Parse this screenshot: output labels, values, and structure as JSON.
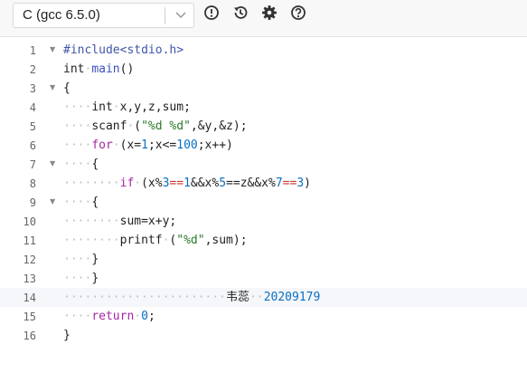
{
  "toolbar": {
    "language": "C (gcc 6.5.0)",
    "icons": [
      "chevron-down-icon",
      "alert-circle-icon",
      "history-icon",
      "gear-icon",
      "help-icon"
    ]
  },
  "editor": {
    "lines": [
      {
        "n": "1",
        "fold": true
      },
      {
        "n": "2"
      },
      {
        "n": "3",
        "fold": true
      },
      {
        "n": "4"
      },
      {
        "n": "5"
      },
      {
        "n": "6"
      },
      {
        "n": "7",
        "fold": true
      },
      {
        "n": "8"
      },
      {
        "n": "9",
        "fold": true
      },
      {
        "n": "10"
      },
      {
        "n": "11"
      },
      {
        "n": "12"
      },
      {
        "n": "13"
      },
      {
        "n": "14",
        "active": true
      },
      {
        "n": "15"
      },
      {
        "n": "16"
      }
    ],
    "tokens": {
      "l1": "#include<stdio.h>",
      "l2_kw": "int",
      "l2_fn": "main",
      "l2_rest": "()",
      "l3": "{",
      "l4_kw": "int",
      "l4_rest": "x,y,z,sum;",
      "l5_fn": "scanf",
      "l5_p1": "(",
      "l5_str": "\"%d %d\"",
      "l5_p2": ",&y,&z);",
      "l6_kw": "for",
      "l6_p1": "(x=",
      "l6_n1": "1",
      "l6_p2": ";x<=",
      "l6_n2": "100",
      "l6_p3": ";x++)",
      "l7": "{",
      "l8_kw": "if",
      "l8_p1": "(x%",
      "l8_n1": "3",
      "l8_p2": "==",
      "l8_n2": "1",
      "l8_p3": "&&x%",
      "l8_n3": "5",
      "l8_p4": "==z&&x%",
      "l8_n4": "7",
      "l8_p5": "==",
      "l8_n5": "3",
      "l8_p6": ")",
      "l9": "{",
      "l10": "sum=x+y;",
      "l11_fn": "printf",
      "l11_p1": "(",
      "l11_str": "\"%d\"",
      "l11_p2": ",sum);",
      "l12": "}",
      "l13": "}",
      "l14_name": "韦蕊",
      "l14_num": "20209179",
      "l15_kw": "return",
      "l15_num": "0",
      "l15_p": ";",
      "l16": "}"
    }
  }
}
